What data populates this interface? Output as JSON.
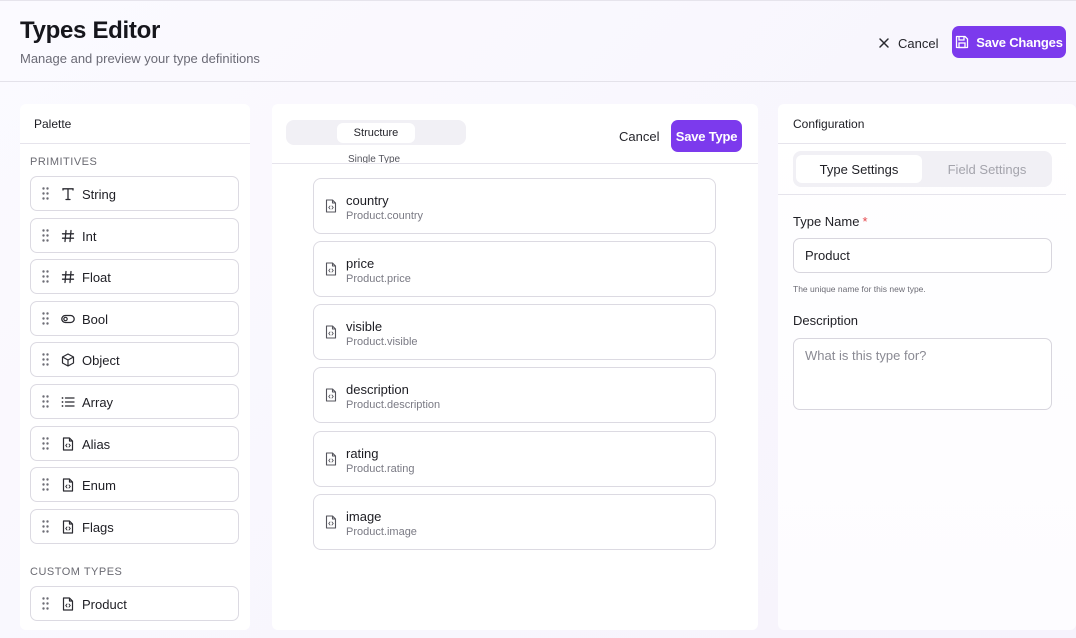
{
  "header": {
    "title": "Types Editor",
    "subtitle": "Manage and preview your type definitions",
    "cancel_label": "Cancel",
    "save_label": "Save Changes"
  },
  "palette": {
    "title": "Palette",
    "primitives_label": "PRIMITIVES",
    "custom_label": "CUSTOM TYPES",
    "primitives": [
      {
        "label": "String",
        "icon": "text-icon"
      },
      {
        "label": "Int",
        "icon": "hash-icon"
      },
      {
        "label": "Float",
        "icon": "hash-icon"
      },
      {
        "label": "Bool",
        "icon": "toggle-icon"
      },
      {
        "label": "Object",
        "icon": "cube-icon"
      },
      {
        "label": "Array",
        "icon": "list-icon"
      },
      {
        "label": "Alias",
        "icon": "file-code-icon"
      },
      {
        "label": "Enum",
        "icon": "file-code-icon"
      },
      {
        "label": "Flags",
        "icon": "file-code-icon"
      }
    ],
    "custom_types": [
      {
        "label": "Product",
        "icon": "file-code-icon"
      }
    ]
  },
  "structure": {
    "tab_label": "Structure",
    "caption": "Single Type",
    "cancel_label": "Cancel",
    "save_label": "Save Type",
    "fields": [
      {
        "name": "country",
        "path": "Product.country"
      },
      {
        "name": "price",
        "path": "Product.price"
      },
      {
        "name": "visible",
        "path": "Product.visible"
      },
      {
        "name": "description",
        "path": "Product.description"
      },
      {
        "name": "rating",
        "path": "Product.rating"
      },
      {
        "name": "image",
        "path": "Product.image"
      }
    ]
  },
  "config": {
    "title": "Configuration",
    "tabs": [
      "Type Settings",
      "Field Settings"
    ],
    "type_name_label": "Type Name",
    "required_mark": "*",
    "type_name_value": "Product",
    "type_name_hint": "The unique name for this new type.",
    "description_label": "Description",
    "description_placeholder": "What is this type for?"
  },
  "colors": {
    "accent": "#7c3aed",
    "required": "#e5484d"
  }
}
